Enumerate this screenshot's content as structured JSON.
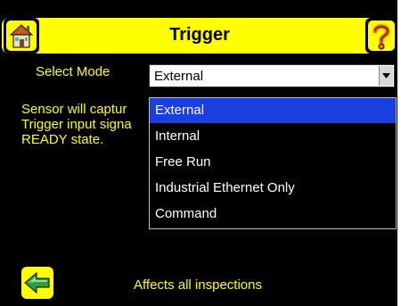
{
  "header": {
    "title": "Trigger",
    "home_icon": "home-icon",
    "help_icon": "help-icon"
  },
  "mode": {
    "label": "Select Mode",
    "selected_value": "External"
  },
  "description": {
    "lines": [
      "Sensor will captur",
      "Trigger input signa",
      "READY state."
    ]
  },
  "dropdown": {
    "options": [
      "External",
      "Internal",
      "Free Run",
      "Industrial Ethernet Only",
      "Command"
    ]
  },
  "footer": {
    "back_icon": "back-arrow-icon",
    "text": "Affects all inspections"
  },
  "colors": {
    "accent": "#ffff00",
    "background": "#000000",
    "selection": "#1b3fdf"
  }
}
